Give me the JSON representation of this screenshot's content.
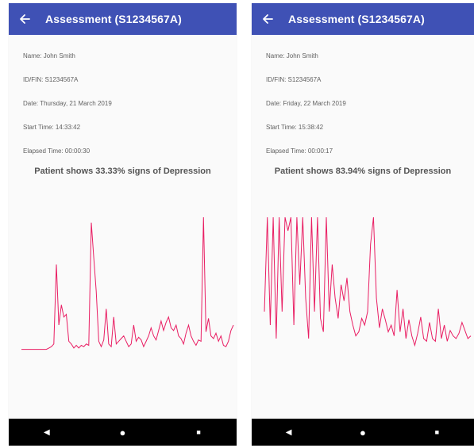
{
  "screens": [
    {
      "title": "Assessment (S1234567A)",
      "name": "Name: John Smith",
      "id": "ID/FIN: S1234567A",
      "date": "Date: Thursday, 21 March 2019",
      "start": "Start Time: 14:33:42",
      "elapsed": "Elapsed Time: 00:00:30",
      "result": "Patient shows 33.33% signs of Depression",
      "chart_data": {
        "type": "line",
        "series_color": "#e91e63",
        "ylim": [
          0,
          10
        ],
        "values": [
          0.2,
          0.2,
          0.2,
          0.2,
          0.2,
          0.2,
          0.2,
          0.2,
          0.2,
          0.2,
          0.2,
          0.3,
          0.4,
          0.6,
          6.5,
          2,
          3.5,
          2.6,
          2.8,
          0.8,
          0.6,
          0.3,
          0.5,
          0.3,
          0.5,
          0.4,
          0.6,
          0.5,
          9.6,
          7,
          4.5,
          0.8,
          0.4,
          0.9,
          3.2,
          0.6,
          0.4,
          2.6,
          0.6,
          0.8,
          1,
          1.2,
          0.8,
          0.4,
          0.6,
          2,
          0.8,
          1.1,
          0.9,
          0.4,
          0.8,
          1.2,
          1.8,
          1.2,
          0.9,
          1.6,
          2.3,
          1.6,
          2.2,
          2.6,
          1.8,
          1.6,
          2,
          1.2,
          1,
          0.6,
          1.4,
          2,
          1.2,
          0.8,
          0.5,
          0.9,
          0.8,
          10,
          1.5,
          2.5,
          1.2,
          1,
          1.4,
          0.8,
          1.2,
          0.5,
          0.4,
          0.8,
          1.6,
          2
        ]
      },
      "nav": {
        "back_glyph": "◀",
        "home_glyph": "●",
        "recents_glyph": "■"
      }
    },
    {
      "title": "Assessment (S1234567A)",
      "name": "Name: John Smith",
      "id": "ID/FIN: S1234567A",
      "date": "Date: Friday, 22 March 2019",
      "start": "Start Time: 15:38:42",
      "elapsed": "Elapsed Time: 00:00:17",
      "result": "Patient shows 83.94% signs of Depression",
      "chart_data": {
        "type": "line",
        "series_color": "#e91e63",
        "ylim": [
          0,
          10
        ],
        "values": [
          3,
          10,
          2,
          10,
          1,
          10,
          3,
          10,
          9,
          10,
          2,
          10,
          5,
          10,
          4,
          1,
          10,
          3,
          10,
          2.5,
          1.5,
          10,
          3,
          6.5,
          4,
          2.5,
          5,
          3.8,
          5.5,
          3,
          2,
          1.2,
          1.5,
          2.5,
          2,
          3,
          8,
          10,
          4,
          1.8,
          3.2,
          2.4,
          1.5,
          2,
          1.2,
          4.6,
          1.5,
          3.2,
          1,
          2.4,
          1.2,
          0.5,
          1.4,
          2.6,
          1,
          0.8,
          2.2,
          1,
          0.8,
          3.2,
          1,
          2,
          0.8,
          1.6,
          1.2,
          1,
          1.4,
          2.2,
          1.6,
          1,
          1.2
        ]
      },
      "nav": {
        "back_glyph": "◀",
        "home_glyph": "●",
        "recents_glyph": "■"
      }
    }
  ]
}
